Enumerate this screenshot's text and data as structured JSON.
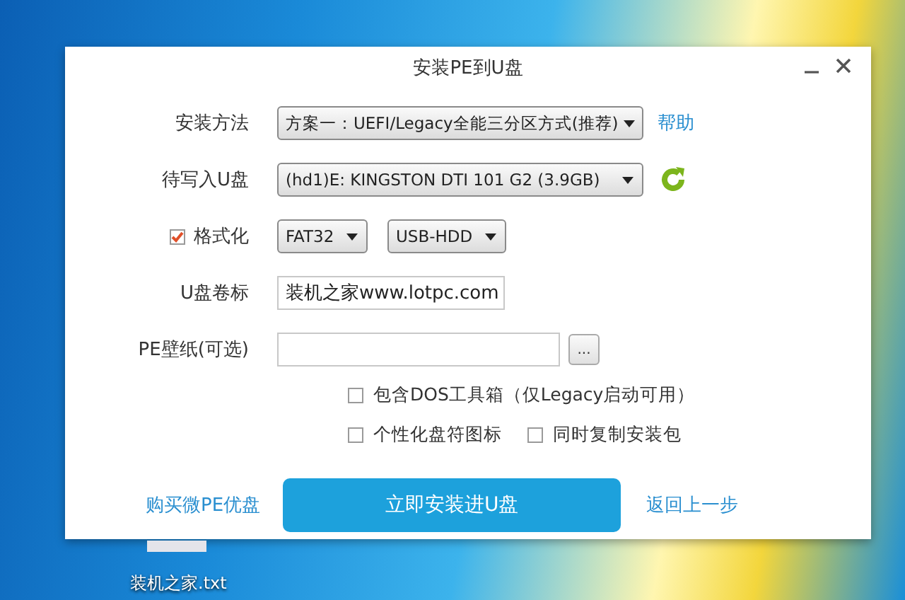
{
  "window": {
    "title": "安装PE到U盘"
  },
  "form": {
    "install_method": {
      "label": "安装方法",
      "value": "方案一：UEFI/Legacy全能三分区方式(推荐)",
      "link": "帮助"
    },
    "target_drive": {
      "label": "待写入U盘",
      "value": "(hd1)E: KINGSTON DTI 101 G2 (3.9GB)"
    },
    "format": {
      "label": "格式化",
      "checked": true,
      "filesystem": "FAT32",
      "boot_mode": "USB-HDD"
    },
    "volume_label": {
      "label": "U盘卷标",
      "value": "装机之家www.lotpc.com"
    },
    "wallpaper": {
      "label": "PE壁纸(可选)",
      "browse": "..."
    },
    "option_rows": [
      {
        "items": [
          {
            "label": "包含DOS工具箱（仅Legacy启动可用）",
            "checked": false
          }
        ]
      },
      {
        "items": [
          {
            "label": "个性化盘符图标",
            "checked": false
          },
          {
            "label": "同时复制安装包",
            "checked": false
          }
        ]
      }
    ]
  },
  "footer": {
    "left_link": "购买微PE优盘",
    "primary_button": "立即安装进U盘",
    "right_link": "返回上一步"
  },
  "desktop_icon": {
    "label": "装机之家.txt"
  }
}
